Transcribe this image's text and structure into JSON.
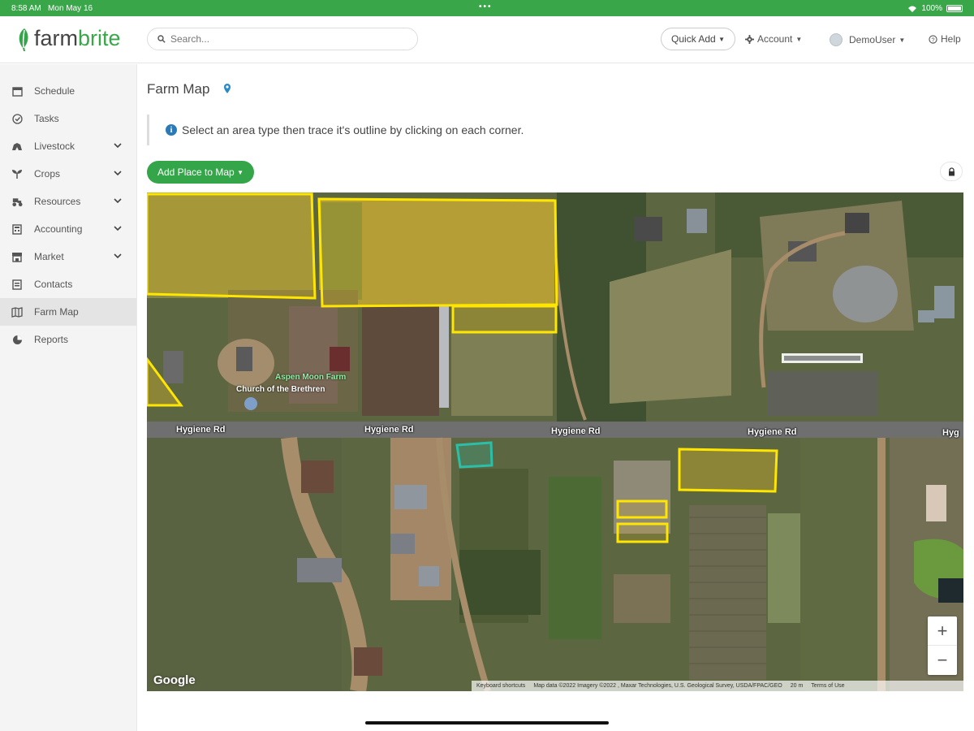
{
  "status_bar": {
    "time": "8:58 AM",
    "date": "Mon May 16",
    "battery": "100%"
  },
  "header": {
    "logo_prefix": "farm",
    "logo_suffix": "brite",
    "search_placeholder": "Search...",
    "quick_add": "Quick Add",
    "account": "Account",
    "user": "DemoUser",
    "help": "Help"
  },
  "sidebar": {
    "items": [
      {
        "label": "Schedule",
        "icon": "calendar-icon"
      },
      {
        "label": "Tasks",
        "icon": "check-circle-icon"
      },
      {
        "label": "Livestock",
        "icon": "livestock-icon"
      },
      {
        "label": "Crops",
        "icon": "sprout-icon"
      },
      {
        "label": "Resources",
        "icon": "tractor-icon"
      },
      {
        "label": "Accounting",
        "icon": "calculator-icon"
      },
      {
        "label": "Market",
        "icon": "store-icon"
      },
      {
        "label": "Contacts",
        "icon": "contact-card-icon"
      },
      {
        "label": "Farm Map",
        "icon": "map-icon"
      },
      {
        "label": "Reports",
        "icon": "pie-chart-icon"
      }
    ]
  },
  "main": {
    "title": "Farm Map",
    "info_text": "Select an area type then trace it's outline by clicking on each corner.",
    "add_place": "Add Place to Map"
  },
  "map": {
    "road_labels": [
      "Hygiene Rd",
      "Hygiene Rd",
      "Hygiene Rd",
      "Hygiene Rd",
      "Hyg"
    ],
    "poi_farm": "Aspen Moon Farm",
    "poi_church": "Church of the Brethren",
    "google": "Google",
    "attribution": {
      "shortcuts": "Keyboard shortcuts",
      "map_data": "Map data ©2022 Imagery ©2022 , Maxar Technologies, U.S. Geological Survey, USDA/FPAC/GEO",
      "scale": "20 m",
      "terms": "Terms of Use"
    },
    "zoom_in": "+",
    "zoom_out": "−",
    "colors": {
      "field_outline": "#ffe600",
      "field_fill": "#c8a82a",
      "selected_outline": "#2bbfa8"
    }
  },
  "colors": {
    "brand_green": "#35a54a",
    "info_blue": "#2a7ab8"
  }
}
